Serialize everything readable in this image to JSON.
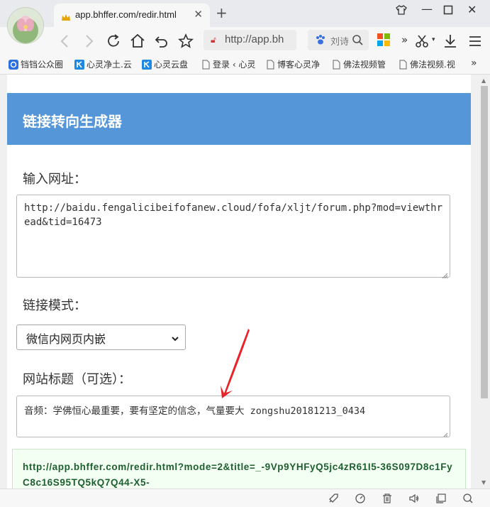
{
  "browser": {
    "tab_title": "app.bhffer.com/redir.html",
    "address_text": "http://app.bh",
    "search_text": "刘诗",
    "more_label": "»",
    "bookmarks": [
      {
        "label": "铛铛公众圈"
      },
      {
        "label": "心灵净土.云"
      },
      {
        "label": "心灵云盘"
      },
      {
        "label": "登录 ‹ 心灵"
      },
      {
        "label": "博客心灵净"
      },
      {
        "label": "佛法视频管"
      },
      {
        "label": "佛法视频.视"
      }
    ],
    "bookmarks_more": "»"
  },
  "page": {
    "title": "链接转向生成器",
    "url_label": "输入网址：",
    "url_value": "http://baidu.fengalicibeifofanew.cloud/fofa/xljt/forum.php?mod=viewthread&tid=16473",
    "mode_label": "链接模式：",
    "mode_selected": "微信内网页内嵌",
    "site_title_label": "网站标题（可选）：",
    "site_title_value": "音频：学佛恒心最重要，要有坚定的信念，气量要大 zongshu20181213_0434",
    "result_url": "http://app.bhffer.com/redir.html?mode=2&title=_-9Vp9YHFyQ5jc4zR61I5-36S097D8c1FyC8c16S95TQ5kQ7Q44-X5-"
  },
  "colors": {
    "header_bg": "#5596d8",
    "result_text": "#1d5e2e",
    "annotation_arrow": "#e8232a"
  }
}
